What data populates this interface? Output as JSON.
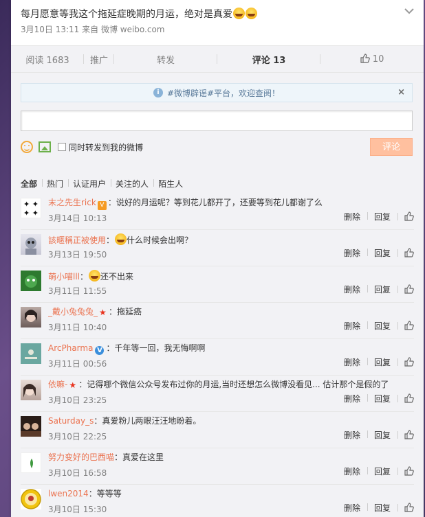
{
  "post": {
    "title": "每月愿意等我这个拖延症晚期的月运，绝对是真爱",
    "date": "3月10日 13:11",
    "source": "来自 微博 weibo.com"
  },
  "actions": {
    "read_label": "阅读 1683",
    "promote_label": "推广",
    "repost_label": "转发",
    "comment_label": "评论 13",
    "like_count": "10"
  },
  "notice": {
    "text": "#微博辟谣#平台，欢迎查阅！"
  },
  "composer": {
    "sync_label": "同时转发到我的微博",
    "submit_label": "评论"
  },
  "filters": [
    "全部",
    "热门",
    "认证用户",
    "关注的人",
    "陌生人"
  ],
  "comment_ops": {
    "delete": "删除",
    "reply": "回复"
  },
  "comments": [
    {
      "user": "末之先生rick",
      "text": "：说好的月运呢？等到花儿都开了，还要等到花儿都谢了么",
      "time": "3月14日 10:13"
    },
    {
      "user": "該暱稱正被使用",
      "text": "什么时候会出啊？",
      "time": "3月13日 19:50"
    },
    {
      "user": "萌小喵lll",
      "text": "还不出来",
      "time": "3月11日 11:55"
    },
    {
      "user": "_戴小兔兔兔_",
      "text": "：拖延癌",
      "time": "3月11日 10:40"
    },
    {
      "user": "ArcPharma",
      "text": "：千年等一回，我无悔啊啊",
      "time": "3月11日 00:56"
    },
    {
      "user": "依嘛-",
      "text": "：记得哪个微信公众号发布过你的月运,当时还想怎么微博没看见... 估计那个是假的了",
      "time": "3月10日 23:25"
    },
    {
      "user": "Saturday_s",
      "text": "：真爱粉儿两眼汪汪地盼着。",
      "time": "3月10日 22:25"
    },
    {
      "user": "努力变好的巴西喵",
      "text": "：真爱在这里",
      "time": "3月10日 16:58"
    },
    {
      "user": "lwen2014",
      "text": "：等等等",
      "time": "3月10日 15:30"
    }
  ]
}
